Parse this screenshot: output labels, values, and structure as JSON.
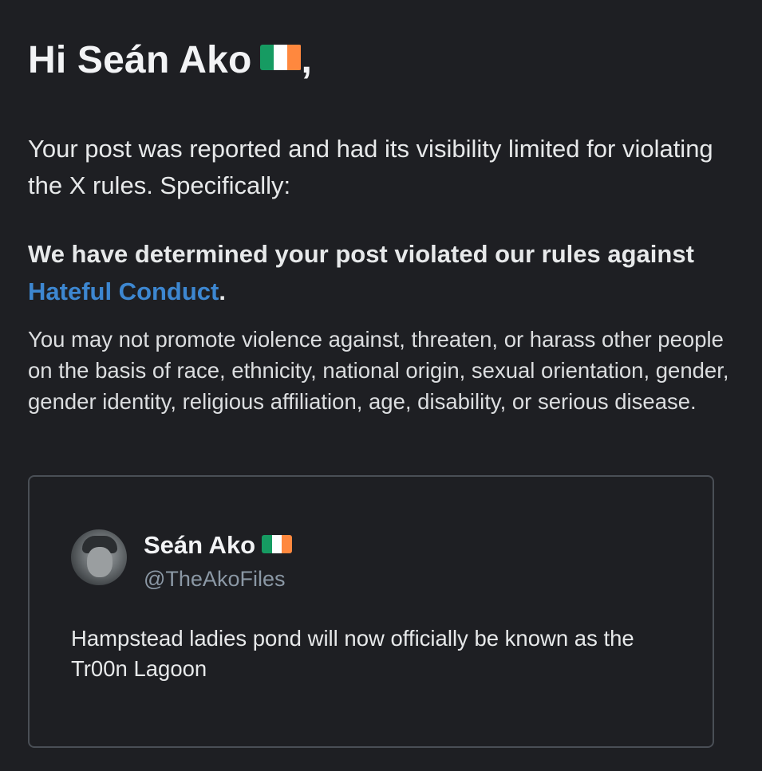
{
  "greeting": {
    "text": "Hi Seán Ako",
    "flag_icon": "ireland-flag-icon",
    "suffix": ","
  },
  "notice": {
    "intro": "Your post was reported and had its visibility limited for violating the X rules. Specifically:",
    "determination_prefix": "We have determined your post violated our rules against ",
    "policy_link": "Hateful Conduct",
    "determination_suffix": ".",
    "policy_description": "You may not promote violence against, threaten, or harass other people on the basis of race, ethnicity, national origin, sexual orientation, gender, gender identity, religious affiliation, age, disability, or serious disease."
  },
  "post": {
    "author_name": "Seán Ako",
    "author_flag_icon": "ireland-flag-icon",
    "handle": "@TheAkoFiles",
    "text": "Hampstead ladies pond will now officially be known as the Tr00n Lagoon"
  },
  "colors": {
    "background": "#1e1f23",
    "text": "#e7e9ea",
    "link": "#3d87d1",
    "handle": "#8b98a5",
    "card_border": "#4a4f56",
    "flag_green": "#169b62",
    "flag_white": "#ffffff",
    "flag_orange": "#ff883e"
  }
}
